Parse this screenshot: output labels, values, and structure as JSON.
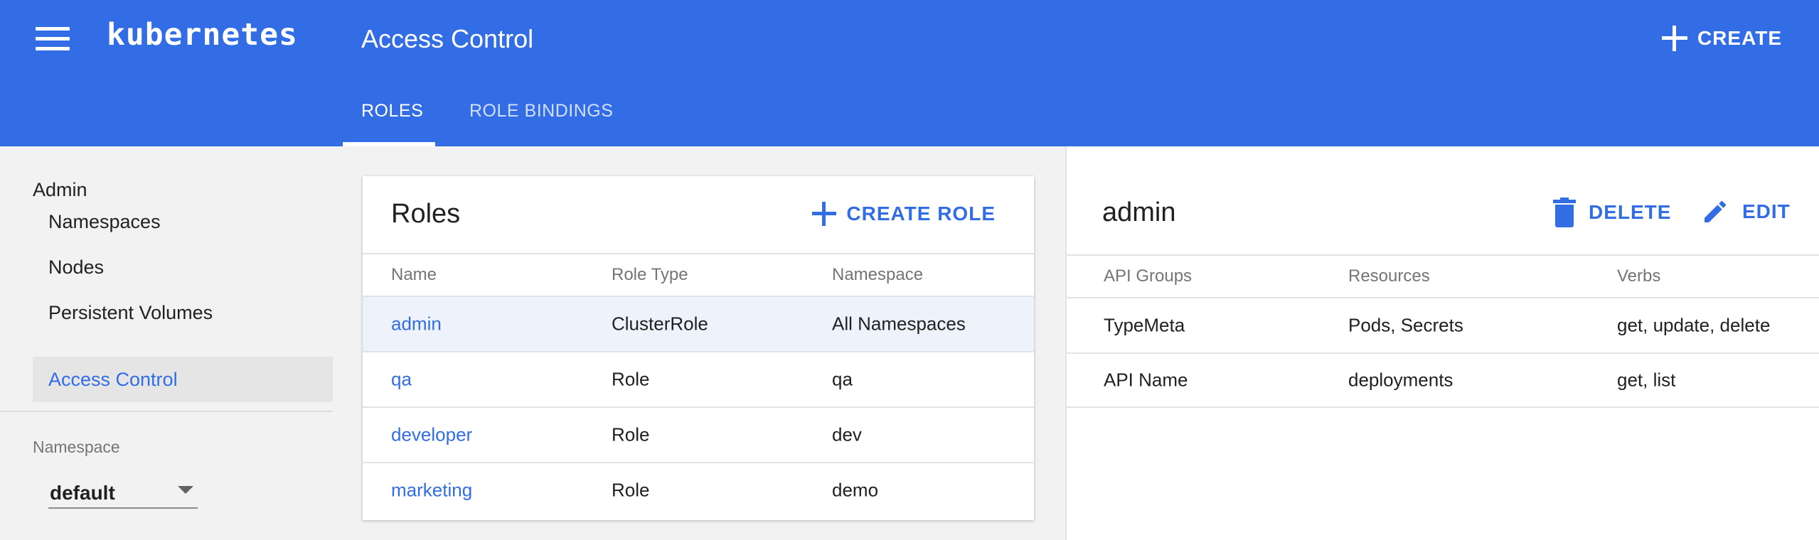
{
  "app": {
    "logo": "kubernetes",
    "page_title": "Access Control",
    "create_label": "CREATE"
  },
  "tabs": [
    {
      "label": "ROLES",
      "active": true
    },
    {
      "label": "ROLE BINDINGS",
      "active": false
    }
  ],
  "sidebar": {
    "header": "Admin",
    "items": [
      {
        "label": "Namespaces",
        "active": false
      },
      {
        "label": "Nodes",
        "active": false
      },
      {
        "label": "Persistent Volumes",
        "active": false
      },
      {
        "label": "Access Control",
        "active": true
      }
    ],
    "namespace_label": "Namespace",
    "namespace_value": "default"
  },
  "roles_card": {
    "title": "Roles",
    "create_label": "CREATE ROLE",
    "columns": [
      "Name",
      "Role Type",
      "Namespace"
    ],
    "rows": [
      {
        "name": "admin",
        "type": "ClusterRole",
        "namespace": "All Namespaces",
        "selected": true
      },
      {
        "name": "qa",
        "type": "Role",
        "namespace": "qa",
        "selected": false
      },
      {
        "name": "developer",
        "type": "Role",
        "namespace": "dev",
        "selected": false
      },
      {
        "name": "marketing",
        "type": "Role",
        "namespace": "demo",
        "selected": false
      }
    ]
  },
  "detail": {
    "title": "admin",
    "delete_label": "DELETE",
    "edit_label": "EDIT",
    "columns": [
      "API Groups",
      "Resources",
      "Verbs"
    ],
    "rows": [
      {
        "api_group": "TypeMeta",
        "resources": "Pods, Secrets",
        "verbs": "get, update, delete"
      },
      {
        "api_group": "API Name",
        "resources": "deployments",
        "verbs": "get, list"
      }
    ]
  },
  "colors": {
    "primary": "#326de6",
    "selected_row": "#eef3fb",
    "sidebar_active": "#e5e5e5"
  }
}
